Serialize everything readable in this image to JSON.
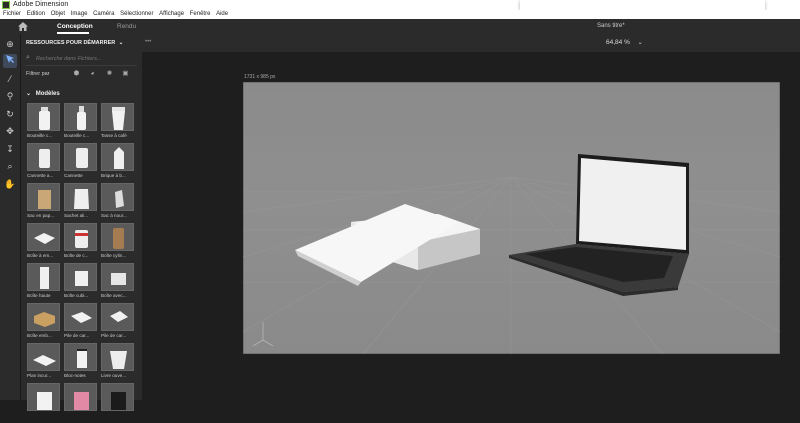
{
  "window": {
    "title": "Adobe Dimension"
  },
  "menu": [
    "Fichier",
    "Edition",
    "Objet",
    "Image",
    "Caméra",
    "Sélectionner",
    "Affichage",
    "Fenêtre",
    "Aide"
  ],
  "tabs": {
    "design": "Conception",
    "render": "Rendu"
  },
  "document": {
    "title": "Sans titre*",
    "zoom": "64,84 %",
    "canvas_size": "1731 x 985 px"
  },
  "panel": {
    "header": "RESSOURCES POUR DÉMARRER",
    "search_placeholder": "Recherche dans Fichiers...",
    "filter_label": "Filtrer par",
    "section": "Modèles",
    "items": [
      "Bouteille c...",
      "Bouteille c...",
      "Tasse à café",
      "Cannette a...",
      "Cannette",
      "Brique à b...",
      "Sac en pap...",
      "Sachet ali...",
      "Sac à nour...",
      "Boîte à em...",
      "Boîte de c...",
      "Boîte cylin...",
      "Boîte haute",
      "Boîte cubi...",
      "Boîte avec...",
      "Boîte emb...",
      "Pile de car...",
      "Pile de car...",
      "Plan incur...",
      "Bloc-notes",
      "Livre ouve..."
    ]
  },
  "icons": {
    "home": "home-icon",
    "tools": [
      "add-icon",
      "select-icon",
      "magic-wand-icon",
      "eyedropper-icon",
      "orbit-icon",
      "pan-icon",
      "dolly-icon",
      "zoom-icon",
      "hand-icon"
    ]
  },
  "colors": {
    "accent": "#7fb2ff",
    "app_bg": "#1e1e1e",
    "panel_bg": "#2b2b2b",
    "canvas_bg": "#8a8a8a"
  }
}
